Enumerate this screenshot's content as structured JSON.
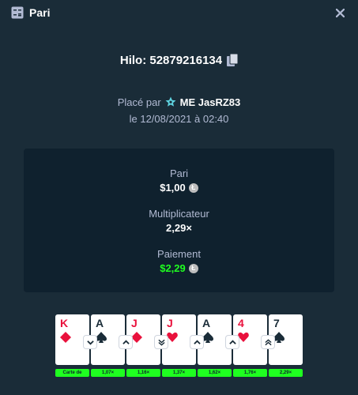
{
  "header": {
    "title": "Pari"
  },
  "bet": {
    "game_id": "Hilo: 52879216134"
  },
  "placed": {
    "prefix": "Placé par",
    "user": "ME JasRZ83",
    "date": "le 12/08/2021 à 02:40"
  },
  "stats": {
    "bet_label": "Pari",
    "bet_value": "$1,00",
    "multiplier_label": "Multiplicateur",
    "multiplier_value": "2,29×",
    "payout_label": "Paiement",
    "payout_value": "$2,29"
  },
  "currency": {
    "symbol": "Ł",
    "color": "#bebebe"
  },
  "colors": {
    "accent_green": "#1fff20",
    "card_red": "#e9113c",
    "background": "#1a2c38",
    "panel": "#0f212e"
  },
  "cards": [
    {
      "rank": "K",
      "suit": "diamond",
      "color": "red",
      "tag": "Carte de"
    },
    {
      "rank": "A",
      "suit": "spade",
      "color": "black",
      "arrow": "chevron-down",
      "tag": "1,07×"
    },
    {
      "rank": "J",
      "suit": "diamond",
      "color": "red",
      "arrow": "chevron-up",
      "tag": "1,16×"
    },
    {
      "rank": "J",
      "suit": "heart",
      "color": "red",
      "arrow": "double-chevron-down",
      "tag": "1,37×"
    },
    {
      "rank": "A",
      "suit": "spade",
      "color": "black",
      "arrow": "chevron-up",
      "tag": "1,62×"
    },
    {
      "rank": "4",
      "suit": "heart",
      "color": "red",
      "arrow": "chevron-up",
      "tag": "1,76×"
    },
    {
      "rank": "7",
      "suit": "spade",
      "color": "black",
      "arrow": "double-chevron-up",
      "tag": "2,29×"
    }
  ]
}
